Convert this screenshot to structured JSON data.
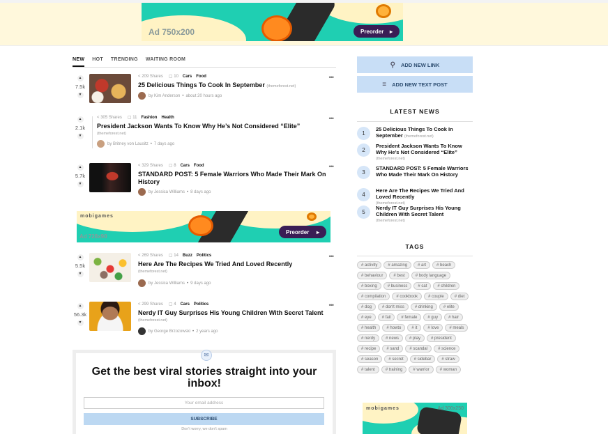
{
  "top_ad": {
    "label": "Ad 750x200",
    "button": "Preorder"
  },
  "tabs": [
    {
      "label": "NEW",
      "active": true
    },
    {
      "label": "HOT",
      "active": false
    },
    {
      "label": "TRENDING",
      "active": false
    },
    {
      "label": "WAITING ROOM",
      "active": false
    }
  ],
  "posts": [
    {
      "votes": "7.5k",
      "shares": "209 Shares",
      "comments": "10",
      "cats": [
        "Cars",
        "Food"
      ],
      "title": "25 Delicious Things To Cook In September",
      "source": "(themeforest.net)",
      "author": "Kim Anderson",
      "time": "about 20 hours ago"
    },
    {
      "votes": "2.1k",
      "shares": "305 Shares",
      "comments": "11",
      "cats": [
        "Fashion",
        "Health"
      ],
      "title": "President Jackson Wants To Know Why He’s Not Considered “Elite”",
      "source": "(themeforest.net)",
      "author": "Britney von Lausitz",
      "time": "7 days ago"
    },
    {
      "votes": "5.7k",
      "shares": "329 Shares",
      "comments": "8",
      "cats": [
        "Cars",
        "Food"
      ],
      "title": "STANDARD POST: 5 Female Warriors Who Made Their Mark On History",
      "source": "",
      "author": "Jessica Williams",
      "time": "8 days ago"
    },
    {
      "votes": "5.5k",
      "shares": "269 Shares",
      "comments": "14",
      "cats": [
        "Buzz",
        "Politics"
      ],
      "title": "Here Are The Recipes We Tried And Loved Recently",
      "source": "(themeforest.net)",
      "author": "Jessica Williams",
      "time": "9 days ago"
    },
    {
      "votes": "56.3k",
      "shares": "299 Shares",
      "comments": "4",
      "cats": [
        "Cars",
        "Politics"
      ],
      "title": "Nerdy IT Guy Surprises His Young Children With Secret Talent",
      "source": "(themeforest.net)",
      "author": "George Brzozowski",
      "time": "2 years ago"
    }
  ],
  "author_prefix": "by",
  "mid_ad": {
    "brand": "mobigames",
    "label": "Ad 728x90",
    "button": "Preorder"
  },
  "newsletter": {
    "title": "Get the best viral stories straight into your inbox!",
    "placeholder": "Your email address",
    "button": "SUBSCRIBE",
    "note": "Don't worry, we don't spam"
  },
  "sidebar": {
    "add_link": "ADD NEW LINK",
    "add_text": "ADD NEW TEXT POST",
    "latest_title": "LATEST NEWS",
    "latest": [
      {
        "n": "1",
        "title": "25 Delicious Things To Cook In September",
        "source": "(themeforest.net)"
      },
      {
        "n": "2",
        "title": "President Jackson Wants To Know Why He’s Not Considered “Elite”",
        "source": "(themeforest.net)"
      },
      {
        "n": "3",
        "title": "STANDARD POST: 5 Female Warriors Who Made Their Mark On History",
        "source": ""
      },
      {
        "n": "4",
        "title": "Here Are The Recipes We Tried And Loved Recently",
        "source": "(themeforest.net)"
      },
      {
        "n": "5",
        "title": "Nerdy IT Guy Surprises His Young Children With Secret Talent",
        "source": "(themeforest.net)"
      }
    ],
    "tags_title": "TAGS",
    "tags": [
      "activity",
      "amazing",
      "art",
      "beach",
      "behaviour",
      "best",
      "body language",
      "boxing",
      "business",
      "cat",
      "children",
      "compilation",
      "cookbook",
      "couple",
      "diet",
      "dog",
      "don't miss",
      "drinking",
      "elite",
      "eye",
      "fail",
      "female",
      "guy",
      "hair",
      "health",
      "howto",
      "it",
      "love",
      "meals",
      "nerdy",
      "news",
      "play",
      "president",
      "recipe",
      "sand",
      "scandal",
      "science",
      "season",
      "secret",
      "sidebar",
      "straw",
      "talent",
      "training",
      "warrior",
      "woman"
    ],
    "ad": {
      "brand": "mobigames",
      "label": "Ad 300x250"
    }
  }
}
